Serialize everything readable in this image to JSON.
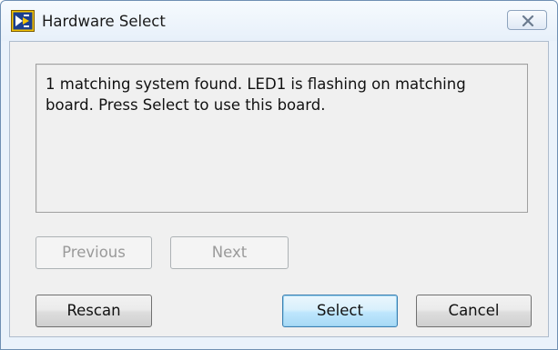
{
  "window": {
    "title": "Hardware Select",
    "close_symbol": "close-icon"
  },
  "message": "1 matching system found. LED1 is flashing on matching board. Press Select to use this board.",
  "buttons": {
    "previous": "Previous",
    "next": "Next",
    "rescan": "Rescan",
    "select": "Select",
    "cancel": "Cancel"
  },
  "colors": {
    "frame": "#eaf2fb",
    "client": "#f0f0f0",
    "default_button": "#bee6fd",
    "disabled_text": "#9a9a9a"
  }
}
